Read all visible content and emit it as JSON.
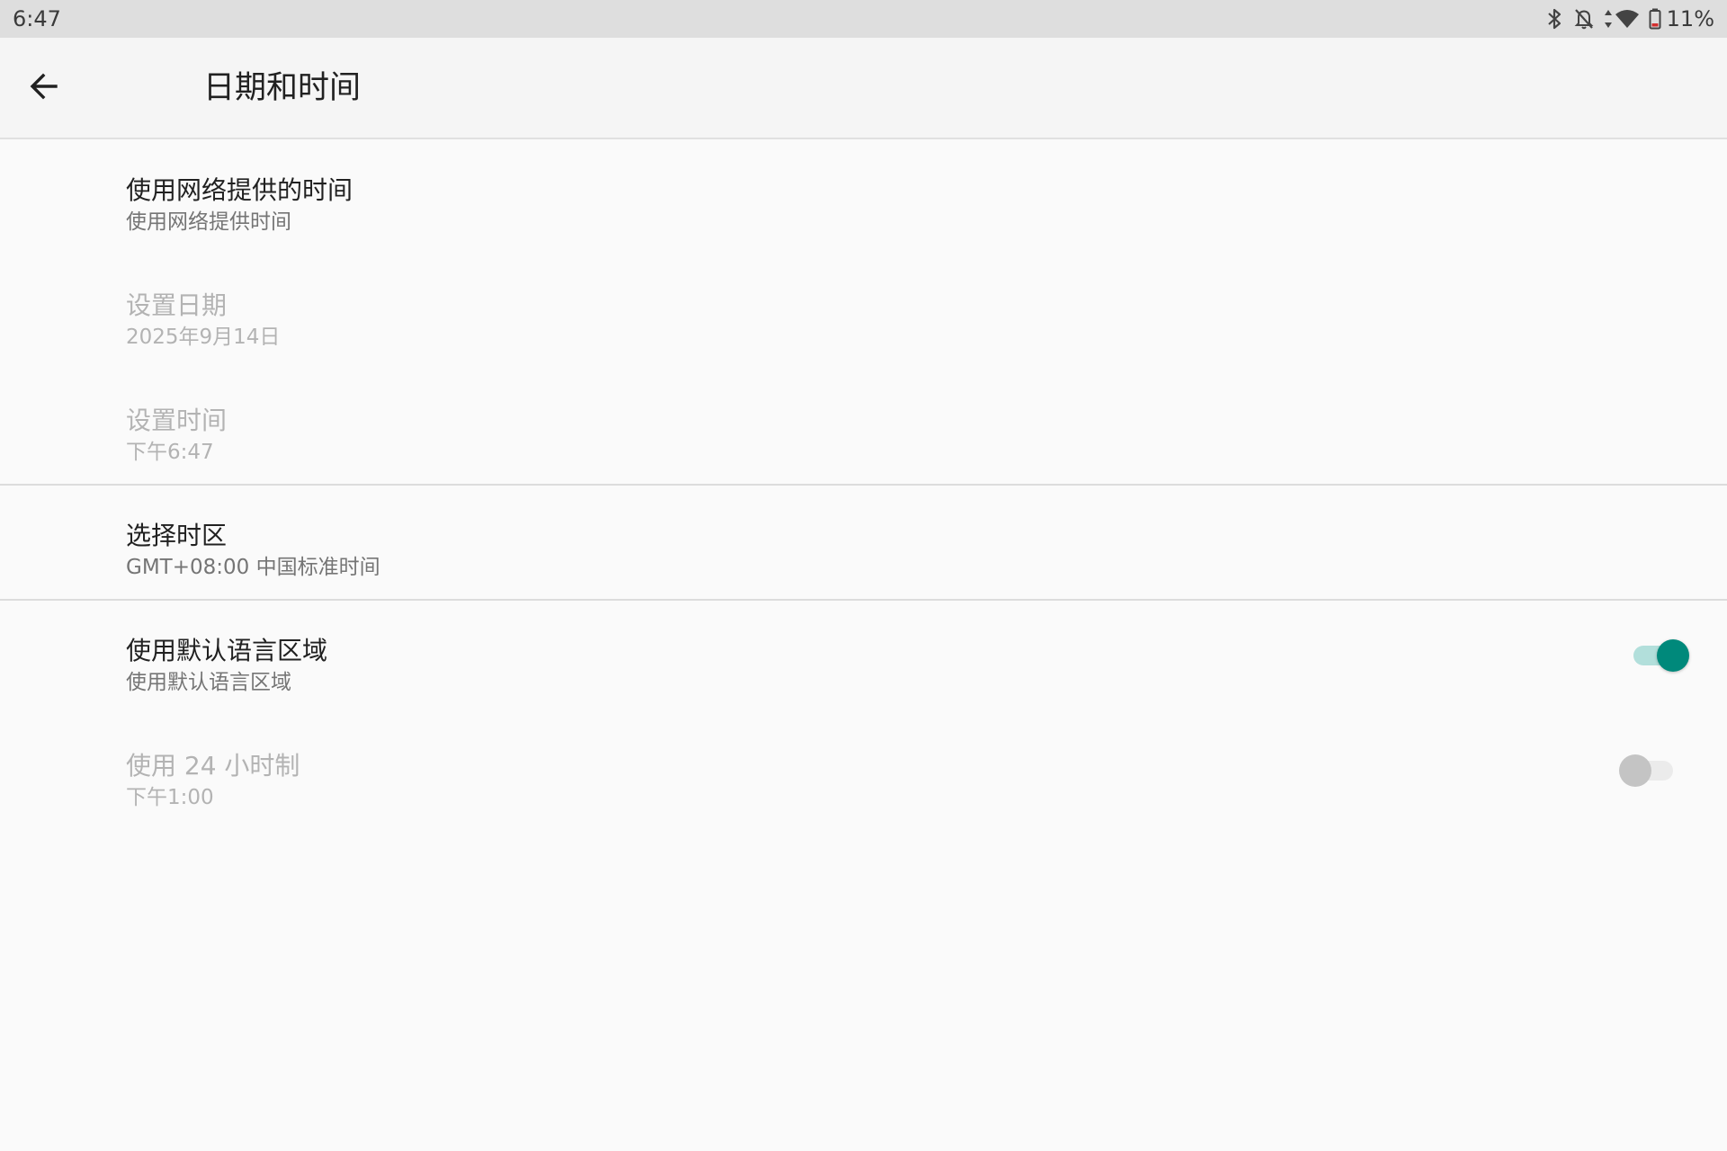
{
  "status_bar": {
    "time": "6:47",
    "battery_percent": "11%",
    "icons": [
      "bluetooth-icon",
      "notifications-off-icon",
      "data-arrows-icon",
      "wifi-icon",
      "battery-icon"
    ]
  },
  "toolbar": {
    "title": "日期和时间",
    "back_icon": "arrow-back-icon"
  },
  "items": [
    {
      "title": "使用网络提供的时间",
      "summary": "使用网络提供时间",
      "enabled": true
    },
    {
      "title": "设置日期",
      "summary": "2025年9月14日",
      "enabled": false
    },
    {
      "title": "设置时间",
      "summary": "下午6:47",
      "enabled": false
    },
    {
      "title": "选择时区",
      "summary": "GMT+08:00 中国标准时间",
      "enabled": true
    },
    {
      "title": "使用默认语言区域",
      "summary": "使用默认语言区域",
      "enabled": true,
      "switch": "on"
    },
    {
      "title": "使用 24 小时制",
      "summary": "下午1:00",
      "enabled": false,
      "switch": "off"
    }
  ],
  "colors": {
    "accent": "#00897b",
    "accent_track": "#b2dfdb",
    "status_bar_bg": "#dedede",
    "toolbar_bg": "#f5f5f5",
    "page_bg": "#fafafa"
  }
}
